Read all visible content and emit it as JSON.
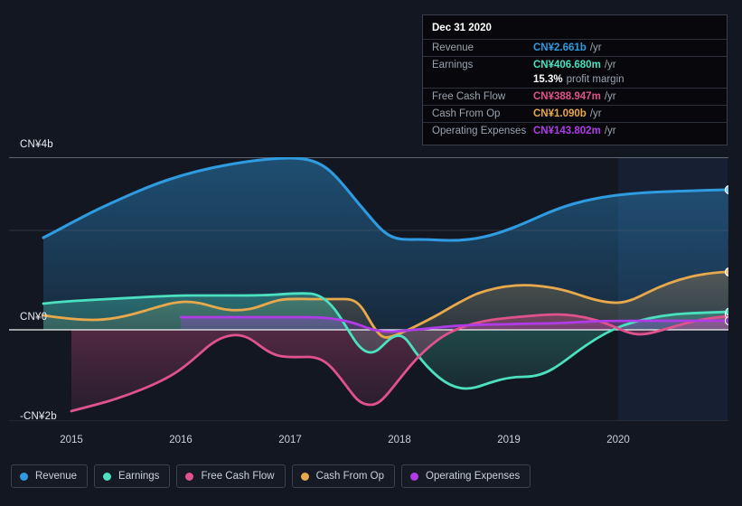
{
  "tooltip": {
    "date": "Dec 31 2020",
    "rows": [
      {
        "label": "Revenue",
        "value": "CN¥2.661b",
        "unit": "/yr",
        "color": "#2f9be0"
      },
      {
        "label": "Earnings",
        "value": "CN¥406.680m",
        "unit": "/yr",
        "color": "#4ae0c0"
      },
      {
        "label": "Free Cash Flow",
        "value": "CN¥388.947m",
        "unit": "/yr",
        "color": "#e0528c"
      },
      {
        "label": "Cash From Op",
        "value": "CN¥1.090b",
        "unit": "/yr",
        "color": "#e8a84c"
      },
      {
        "label": "Operating Expenses",
        "value": "CN¥143.802m",
        "unit": "/yr",
        "color": "#b03ce8"
      }
    ],
    "profit_margin_value": "15.3%",
    "profit_margin_label": "profit margin"
  },
  "legend": [
    {
      "label": "Revenue",
      "color": "#2f9be0"
    },
    {
      "label": "Earnings",
      "color": "#4ae0c0"
    },
    {
      "label": "Free Cash Flow",
      "color": "#e0528c"
    },
    {
      "label": "Cash From Op",
      "color": "#e8a84c"
    },
    {
      "label": "Operating Expenses",
      "color": "#b03ce8"
    }
  ],
  "axes": {
    "y_labels": [
      "CN¥4b",
      "CN¥0",
      "-CN¥2b"
    ],
    "x_labels": [
      "2015",
      "2016",
      "2017",
      "2018",
      "2019",
      "2020"
    ]
  },
  "chart_data": {
    "type": "area",
    "title": "",
    "xlabel": "",
    "ylabel": "CN¥",
    "ylim": [
      -2000000000,
      4000000000
    ],
    "yticks": [
      4000000000,
      2000000000,
      0,
      -2000000000
    ],
    "ytick_labels": [
      "CN¥4b",
      "",
      "CN¥0",
      "-CN¥2b"
    ],
    "grid": true,
    "legend_position": "bottom",
    "x": [
      "2014-09",
      "2015",
      "2015-06",
      "2016",
      "2016-06",
      "2017",
      "2017-06",
      "2018",
      "2018-06",
      "2019",
      "2019-06",
      "2020",
      "2020-12"
    ],
    "xticks": [
      "2015",
      "2016",
      "2017",
      "2018",
      "2019",
      "2020"
    ],
    "forecast_region_start": "2020-03",
    "series": [
      {
        "name": "Revenue",
        "color": "#2f9be0",
        "values": [
          1840000000,
          2350000000,
          2930000000,
          3380000000,
          3700000000,
          3930000000,
          3530000000,
          2100000000,
          1960000000,
          2160000000,
          2470000000,
          2610000000,
          2661000000
        ]
      },
      {
        "name": "Earnings",
        "color": "#4ae0c0",
        "values": [
          740000000,
          790000000,
          830000000,
          850000000,
          880000000,
          900000000,
          560000000,
          -170000000,
          -720000000,
          -1180000000,
          -690000000,
          150000000,
          406680000
        ]
      },
      {
        "name": "Free Cash Flow",
        "color": "#e0528c",
        "values": [
          -1870000000,
          -1620000000,
          -1180000000,
          -640000000,
          -890000000,
          -730000000,
          -1030000000,
          -1600000000,
          -420000000,
          530000000,
          610000000,
          120000000,
          388947000
        ]
      },
      {
        "name": "Cash From Op",
        "color": "#e8a84c",
        "values": [
          600000000,
          540000000,
          690000000,
          910000000,
          810000000,
          1010000000,
          1010000000,
          -60000000,
          480000000,
          1070000000,
          1090000000,
          880000000,
          1090000000
        ]
      },
      {
        "name": "Operating Expenses",
        "color": "#b03ce8",
        "values": [
          null,
          null,
          300000000,
          300000000,
          300000000,
          310000000,
          300000000,
          90000000,
          130000000,
          160000000,
          150000000,
          140000000,
          143802000
        ]
      }
    ]
  }
}
